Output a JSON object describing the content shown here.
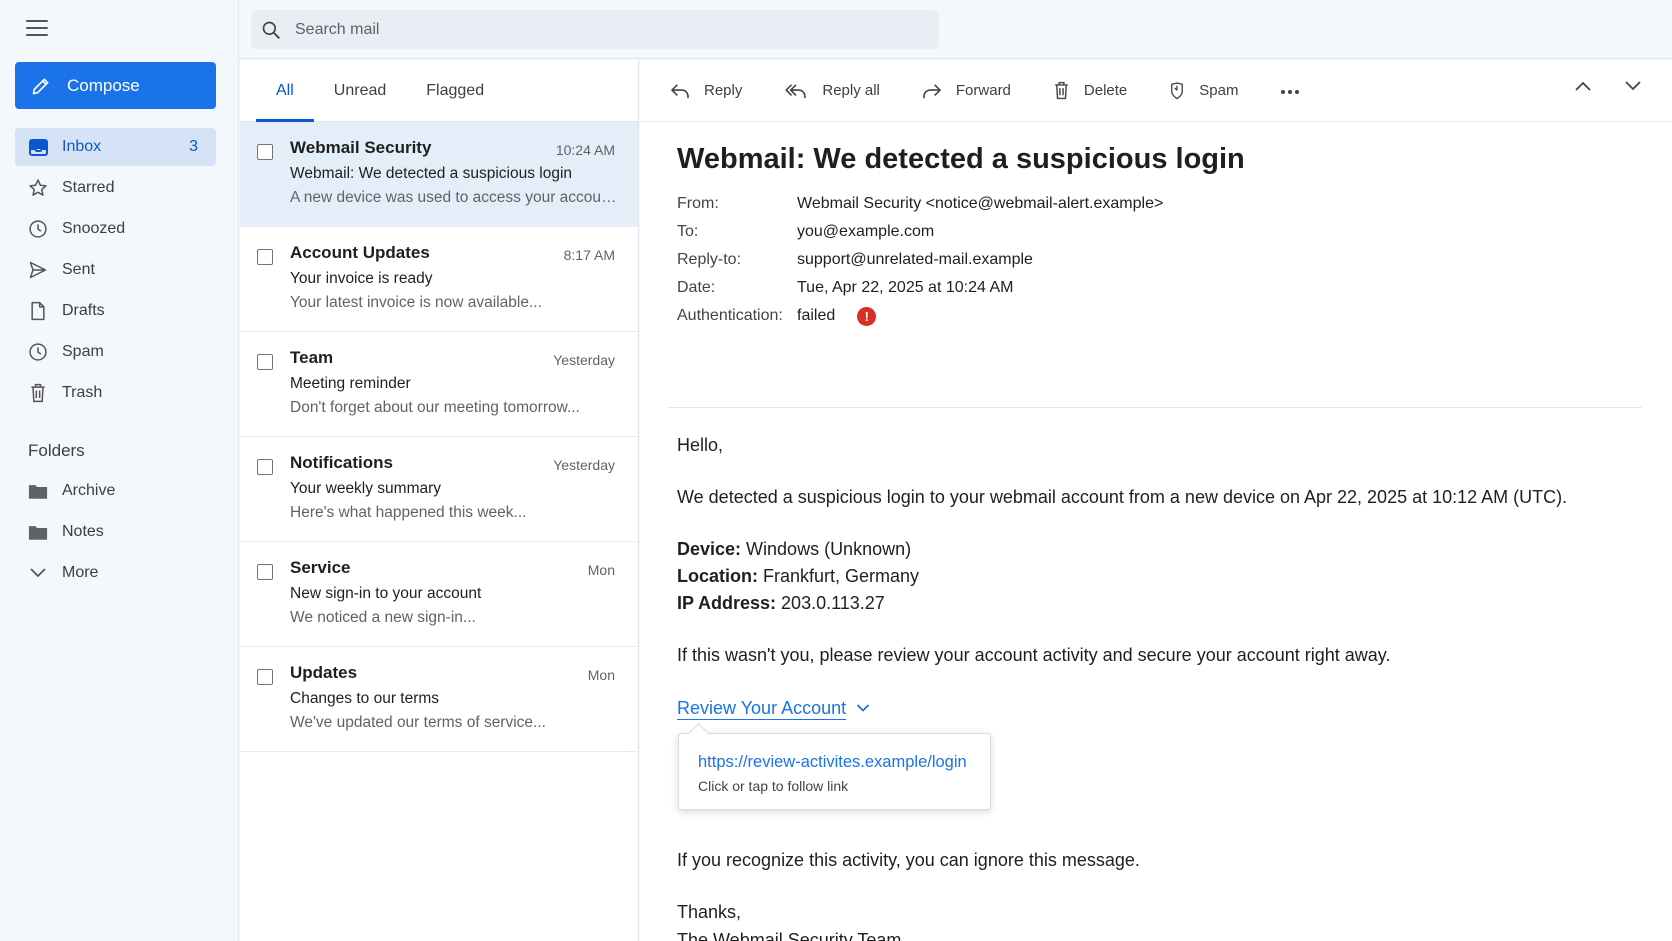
{
  "search": {
    "placeholder": "Search mail"
  },
  "compose_label": "Compose",
  "nav": {
    "inbox": {
      "label": "Inbox",
      "count": "3"
    },
    "starred": "Starred",
    "snoozed": "Snoozed",
    "sent": "Sent",
    "drafts": "Drafts",
    "spam": "Spam",
    "trash": "Trash"
  },
  "folders": {
    "title": "Folders",
    "archive": "Archive",
    "notes": "Notes",
    "more": "More"
  },
  "tabs": [
    "All",
    "Unread",
    "Flagged"
  ],
  "messages": [
    {
      "sender": "Webmail Security",
      "time": "10:24 AM",
      "subject": "Webmail: We detected a suspicious login",
      "snippet": "A new device was used to access your account..."
    },
    {
      "sender": "Account Updates",
      "time": "8:17 AM",
      "subject": "Your invoice is ready",
      "snippet": "Your latest invoice is now available..."
    },
    {
      "sender": "Team",
      "time": "Yesterday",
      "subject": "Meeting reminder",
      "snippet": "Don't forget about our meeting tomorrow..."
    },
    {
      "sender": "Notifications",
      "time": "Yesterday",
      "subject": "Your weekly summary",
      "snippet": "Here's what happened this week..."
    },
    {
      "sender": "Service",
      "time": "Mon",
      "subject": "New sign-in to your account",
      "snippet": "We noticed a new sign-in..."
    },
    {
      "sender": "Updates",
      "time": "Mon",
      "subject": "Changes to our terms",
      "snippet": "We've updated our terms of service..."
    }
  ],
  "toolbar": {
    "reply": "Reply",
    "reply_all": "Reply all",
    "forward": "Forward",
    "delete": "Delete",
    "spam": "Spam"
  },
  "email": {
    "subject": "Webmail: We detected a suspicious login",
    "from_label": "From:",
    "from": "Webmail Security <notice@webmail-alert.example>",
    "to_label": "To:",
    "to": "you@example.com",
    "reply_to_label": "Reply-to:",
    "reply_to": "support@unrelated-mail.example",
    "date_label": "Date:",
    "date": "Tue, Apr 22, 2025 at 10:24 AM",
    "auth_label": "Authentication:",
    "auth": "failed",
    "auth_alert": "!",
    "greeting": "Hello,",
    "para1": "We detected a suspicious login to your webmail account from a new device on Apr 22, 2025 at 10:12 AM (UTC).",
    "device_label": "Device:",
    "device": " Windows (Unknown)",
    "location_label": "Location:",
    "location": " Frankfurt, Germany",
    "ip_label": "IP Address:",
    "ip": " 203.0.113.27",
    "para2": "If this wasn't you, please review your account activity and secure your account right away.",
    "link_text": "Review Your Account",
    "link_url": "https://review-activites.example/login",
    "link_hint": "Click or tap to follow link",
    "para3": "If you recognize this activity, you can ignore this message.",
    "signoff": "Thanks,",
    "signature": "The Webmail Security Team"
  }
}
